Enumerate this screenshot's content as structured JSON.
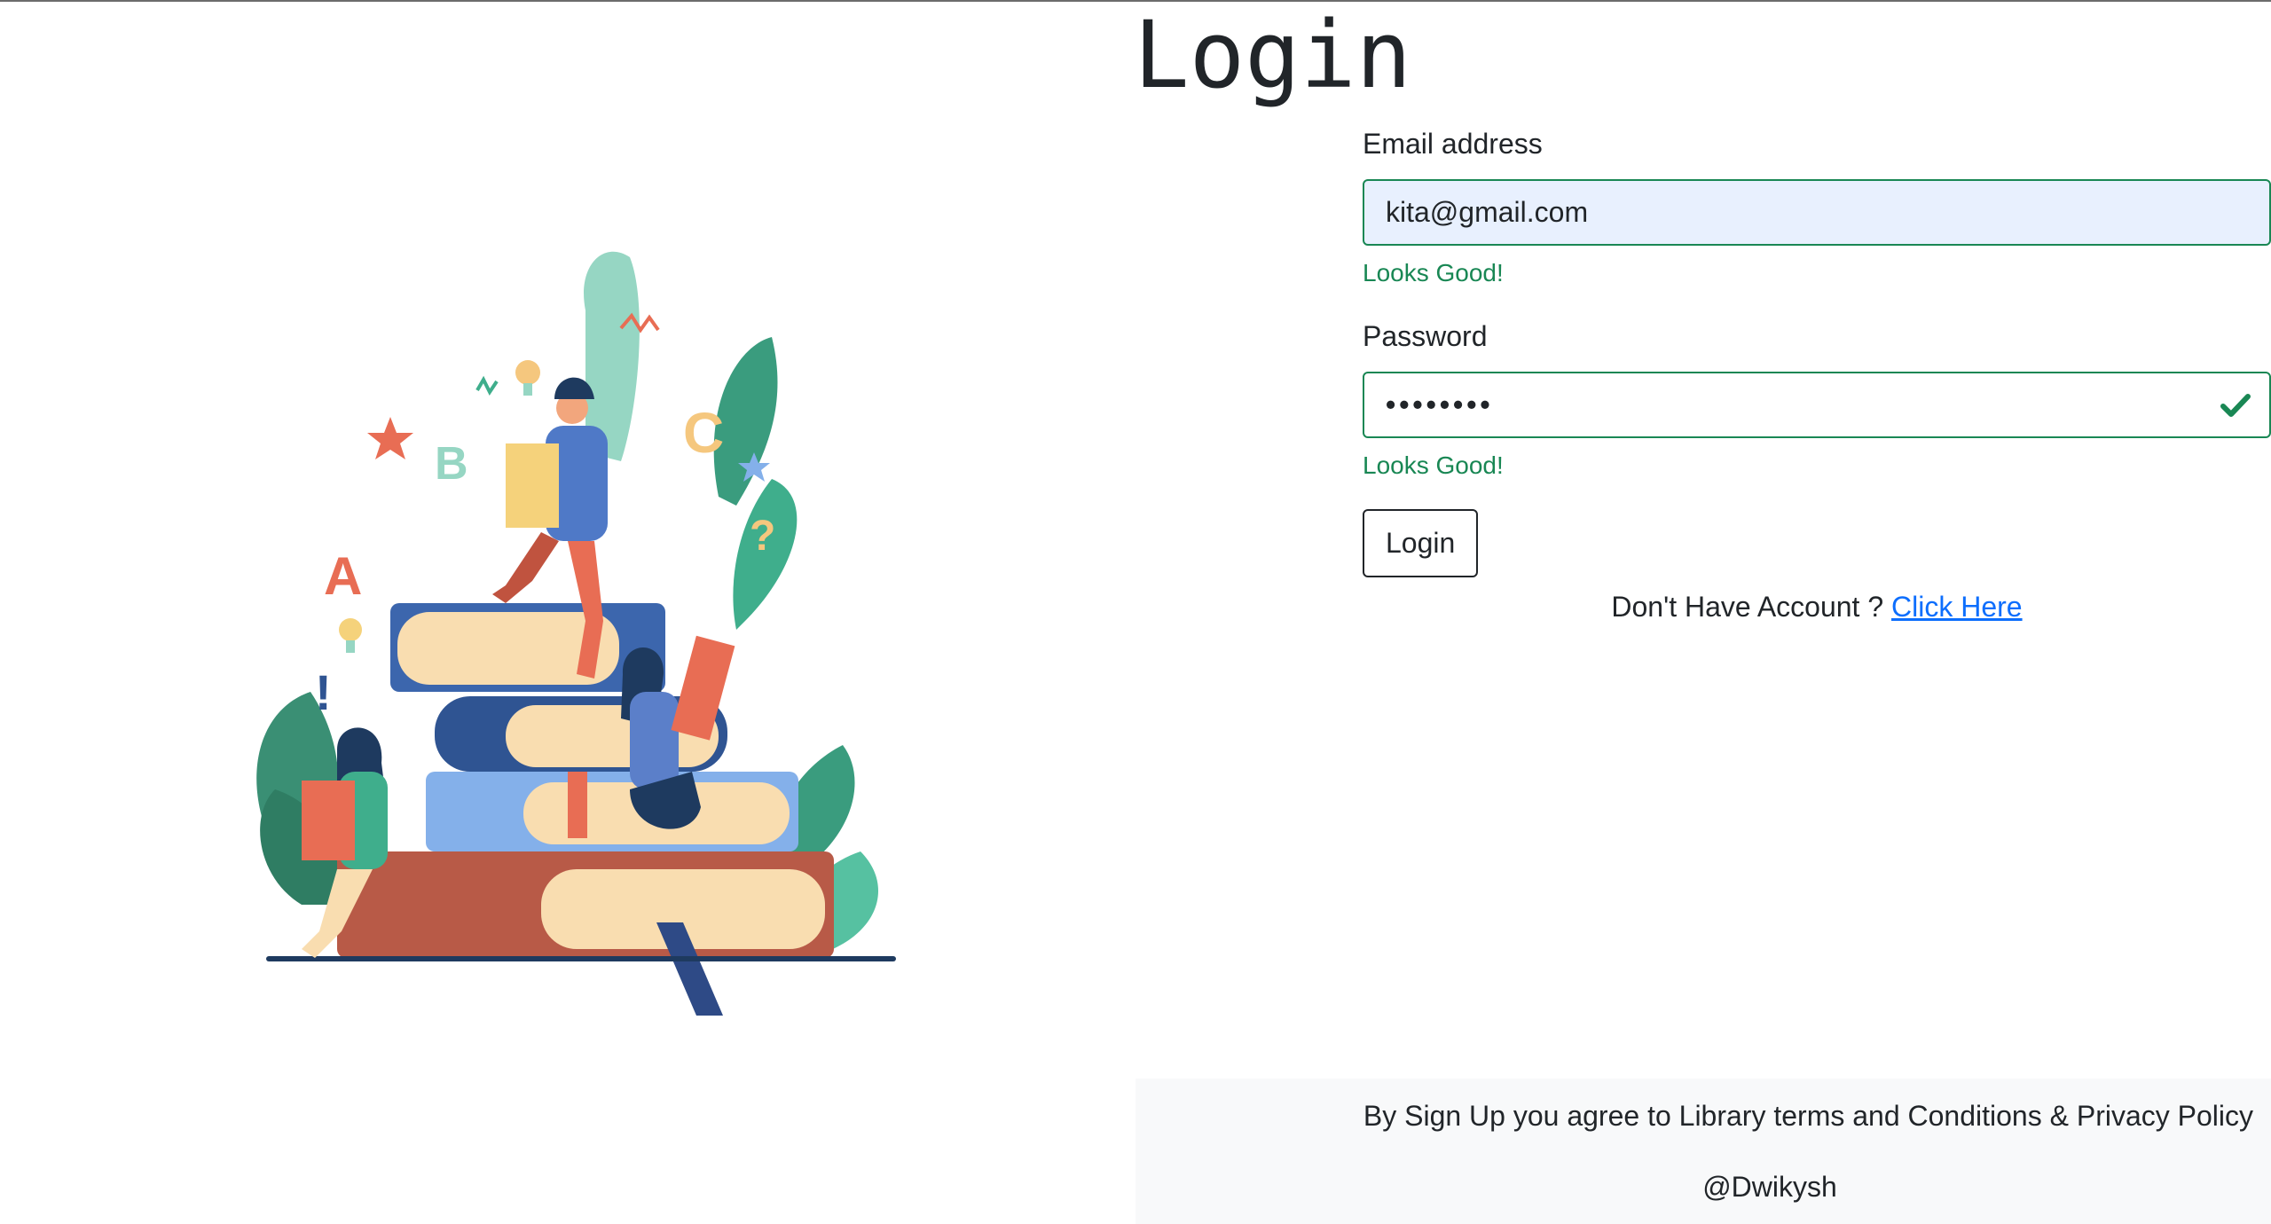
{
  "page": {
    "title": "Login"
  },
  "form": {
    "email_label": "Email address",
    "email_value": "kita@gmail.com",
    "email_feedback": "Looks Good!",
    "password_label": "Password",
    "password_value": "••••••••",
    "password_feedback": "Looks Good!",
    "login_button": "Login"
  },
  "account": {
    "prompt": "Don't Have Account ? ",
    "link": "Click Here"
  },
  "footer": {
    "terms": "By Sign Up you agree to Library terms and Conditions & Privacy Policy",
    "credit": "@Dwikysh"
  },
  "illustration": {
    "letters": [
      "A",
      "B",
      "C"
    ],
    "symbols": [
      "!",
      "?"
    ]
  },
  "colors": {
    "valid": "#198754",
    "link": "#0d6efd",
    "autofill_bg": "#e8f0fe",
    "footer_bg": "#f8f9fa"
  },
  "icons": {
    "valid_check": "check-icon",
    "illustration": "reading-books-illustration"
  }
}
